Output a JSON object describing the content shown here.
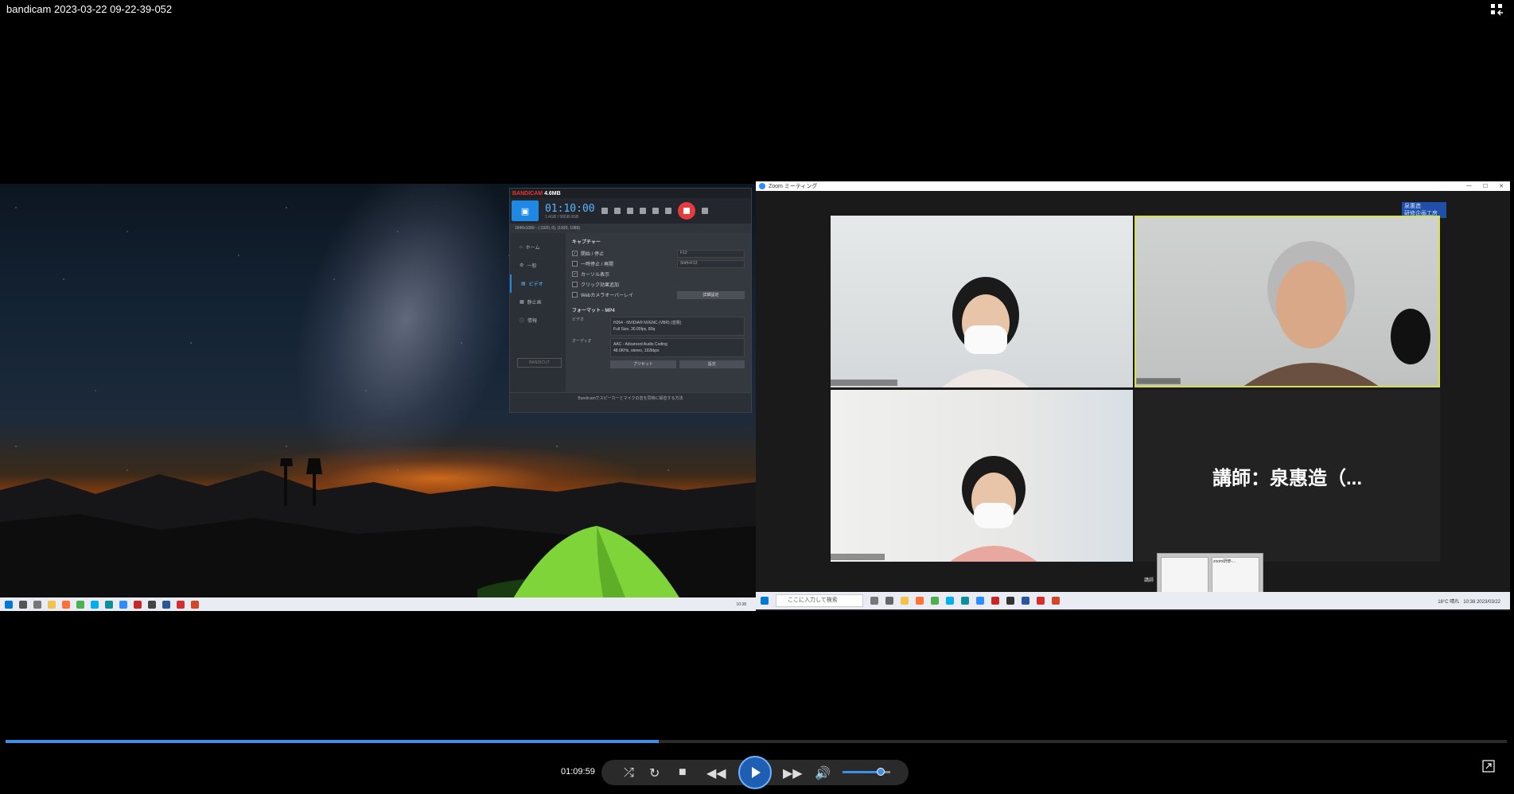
{
  "player": {
    "title": "bandicam 2023-03-22 09-22-39-052",
    "current_time": "01:09:59",
    "progress_fraction": 0.435,
    "volume_fraction": 0.8
  },
  "bandicam": {
    "brand": "BANDICAM",
    "edition": "4.6MB",
    "timer": "01:10:00",
    "size_text": "1.4GB / 58GB.0GB",
    "status": "1840x1089 - (-1920, 0), (1920, 1089)",
    "sidebar": [
      "ホーム",
      "一般",
      "ビデオ",
      "静止画",
      "情報"
    ],
    "logo": "BANDICUT",
    "capture_title": "キャプチャー",
    "capture_items": [
      {
        "label": "開始 / 停止",
        "checked": true,
        "field": "F12"
      },
      {
        "label": "一時停止 / 再開",
        "checked": false,
        "field": "Shift+F12"
      },
      {
        "label": "カーソル表示",
        "checked": true,
        "field": ""
      },
      {
        "label": "クリック効果追加",
        "checked": false,
        "field": ""
      },
      {
        "label": "Webカメラオーバーレイ",
        "checked": false,
        "field": ""
      }
    ],
    "advanced_btn": "詳細設定",
    "format_title": "フォーマット - MP4",
    "video_label": "ビデオ",
    "video_value_1": "H264 - NVIDIA® NVENC (VBR) (音質)",
    "video_value_2": "Full Size, 30.00fps, 80q",
    "audio_label": "オーディオ",
    "audio_value_1": "AAC - Advanced Audio Coding",
    "audio_value_2": "48.0KHz, stereo, 192kbps",
    "preset_btn": "プリセット",
    "settings_btn": "設定",
    "footer": "Bandicamでスピーカーとマイクの音を同時に録音する方法"
  },
  "zoom": {
    "window_title": "Zoom ミーティング",
    "badge_line1": "泉惠造",
    "badge_line2": "研修企画工房",
    "speaker_text": "講師：泉惠造（...",
    "search_placeholder": "ここに入力して検索",
    "tray_weather": "18°C 晴れ",
    "tray_time": "10:38",
    "tray_date": "2023/03/22",
    "left_tray_time": "10:38",
    "preview_title": "zoom研修-...",
    "preview_side_label": "講師"
  },
  "colors": {
    "accent": "#3e8fe8",
    "zoom_highlight": "#d8e04a",
    "record_red": "#e83a3a"
  }
}
